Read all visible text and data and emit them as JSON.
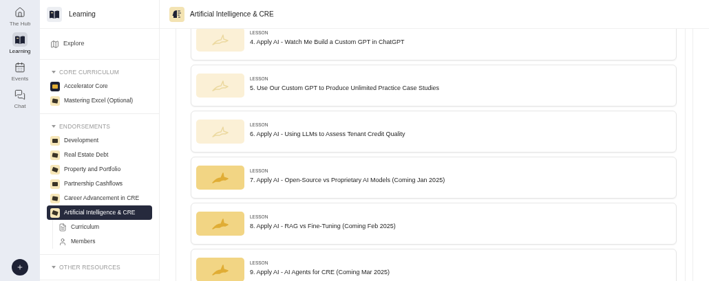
{
  "rail": [
    {
      "kind": "home",
      "label": "The Hub",
      "selected": false
    },
    {
      "kind": "book",
      "label": "Learning",
      "selected": true
    },
    {
      "kind": "calendar",
      "label": "Events",
      "selected": false
    },
    {
      "kind": "chat",
      "label": "Chat",
      "selected": false
    }
  ],
  "sidebar": {
    "title": "Learning",
    "explore": "Explore",
    "sections": [
      {
        "title": "CORE CURRICULUM",
        "expanded": true,
        "items": [
          {
            "label": "Accelerator Core",
            "selected": false
          },
          {
            "label": "Mastering Excel (Optional)",
            "selected": false
          }
        ]
      },
      {
        "title": "ENDORSEMENTS",
        "expanded": true,
        "items": [
          {
            "label": "Development",
            "selected": false
          },
          {
            "label": "Real Estate Debt",
            "selected": false
          },
          {
            "label": "Property and Portfolio",
            "selected": false
          },
          {
            "label": "Partnership Cashflows",
            "selected": false
          },
          {
            "label": "Career Advancement in CRE",
            "selected": false
          },
          {
            "label": "Artificial Intelligence & CRE",
            "selected": true,
            "children": [
              {
                "kind": "document",
                "label": "Curriculum"
              },
              {
                "kind": "person",
                "label": "Members"
              }
            ]
          }
        ]
      },
      {
        "title": "OTHER RESOURCES",
        "expanded": true
      }
    ]
  },
  "header": {
    "title": "Artificial Intelligence & CRE"
  },
  "lessons": [
    {
      "type": "LESSON",
      "title": "4. Apply AI - Watch Me Build a Custom GPT in ChatGPT",
      "faded": true
    },
    {
      "type": "LESSON",
      "title": "5. Use Our Custom GPT to Produce Unlimited Practice Case Studies",
      "faded": true
    },
    {
      "type": "LESSON",
      "title": "6. Apply AI - Using LLMs to Assess Tenant Credit Quality",
      "faded": true
    },
    {
      "type": "LESSON",
      "title": "7. Apply AI - Open-Source vs Proprietary AI Models (Coming Jan 2025)",
      "faded": false
    },
    {
      "type": "LESSON",
      "title": "8. Apply AI - RAG vs Fine-Tuning (Coming Feb 2025)",
      "faded": false
    },
    {
      "type": "LESSON",
      "title": "9. Apply AI - AI Agents for CRE (Coming Mar 2025)",
      "faded": false
    }
  ]
}
